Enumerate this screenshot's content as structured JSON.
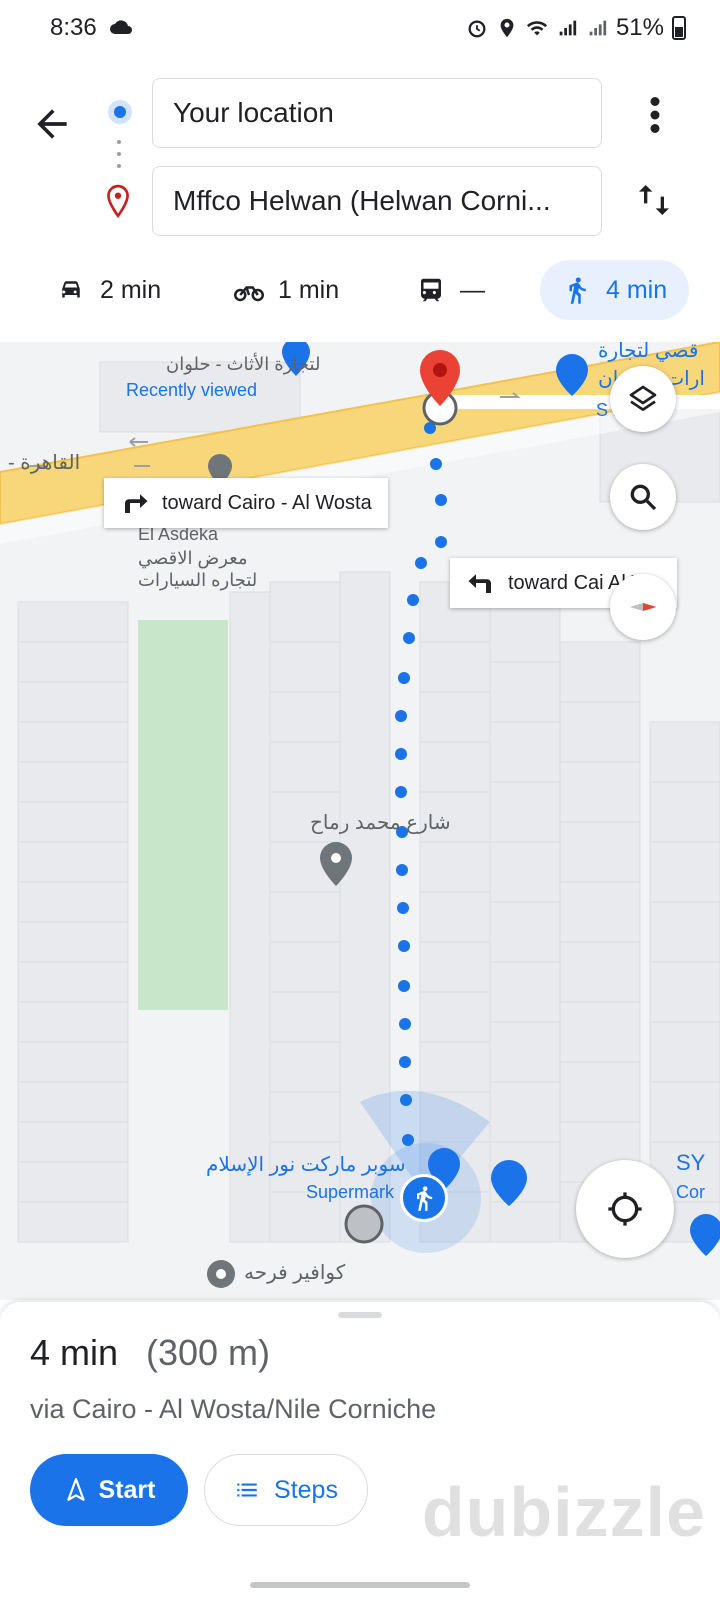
{
  "status": {
    "time": "8:36",
    "battery": "51%",
    "icons": [
      "cloud-icon",
      "alarm-icon",
      "location-icon",
      "wifi-icon",
      "signal-icon",
      "signal-icon",
      "battery-icon"
    ]
  },
  "search": {
    "origin": "Your location",
    "destination": "Mffco Helwan (Helwan Corni..."
  },
  "modes": [
    {
      "icon": "car-icon",
      "label": "2 min"
    },
    {
      "icon": "motorcycle-icon",
      "label": "1 min"
    },
    {
      "icon": "transit-icon",
      "label": "—"
    },
    {
      "icon": "walk-icon",
      "label": "4 min",
      "selected": true
    }
  ],
  "map": {
    "turn_labels": [
      "toward Cairo - Al Wosta",
      "toward Cai  Al Wo"
    ],
    "places": {
      "recently_viewed": "Recently viewed",
      "furniture_ar": "لتجارة الأثاث - حلوان",
      "cairo_road_ar": "القاهرة -",
      "el_asdeka": "El Asdeka",
      "aqsa_ar_1": "معرض الاقصي",
      "aqsa_ar_2": "لتجاره السيارات",
      "street_ar": "شارع محمد رماح",
      "supermarket_ar": "سوبر ماركت نور الإسلام",
      "supermarket": "Supermark",
      "salon_ar": "كوافير فرحه",
      "top_right_ar_1": "قصي لتجارة",
      "top_right_ar_2": "ارات - حلوان",
      "top_right_en": "S   ing ma",
      "sy": "SY",
      "cor": "Cor"
    },
    "colors": {
      "route": "#1a73e8",
      "road": "#f8d77b",
      "destination_pin": "#ea4335",
      "park": "#c8e6c9"
    }
  },
  "sheet": {
    "duration": "4 min",
    "distance": "(300 m)",
    "via": "via Cairo - Al Wosta/Nile Corniche",
    "start_label": "Start",
    "steps_label": "Steps",
    "watermark": "dubizzle"
  }
}
